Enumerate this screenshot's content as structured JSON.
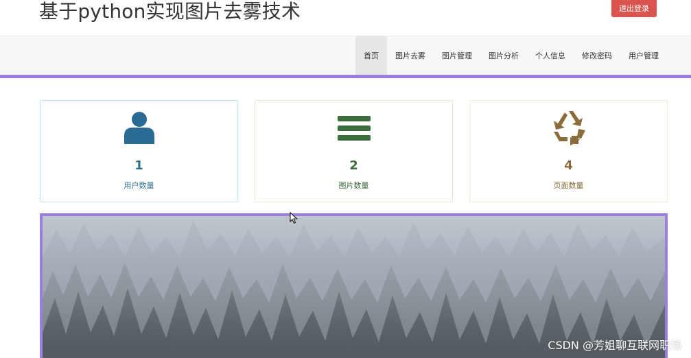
{
  "header": {
    "site_title": "基于python实现图片去雾技术",
    "logout_label": "退出登录"
  },
  "nav": {
    "items": [
      {
        "label": "首页",
        "active": true
      },
      {
        "label": "图片去雾",
        "active": false
      },
      {
        "label": "图片管理",
        "active": false
      },
      {
        "label": "图片分析",
        "active": false
      },
      {
        "label": "个人信息",
        "active": false
      },
      {
        "label": "修改密码",
        "active": false
      },
      {
        "label": "用户管理",
        "active": false
      }
    ]
  },
  "stats": [
    {
      "icon": "user-icon",
      "value": "1",
      "label": "用户数量",
      "color": "#31708f"
    },
    {
      "icon": "list-icon",
      "value": "2",
      "label": "图片数量",
      "color": "#3c6d3c"
    },
    {
      "icon": "recycle-icon",
      "value": "4",
      "label": "页面数量",
      "color": "#8a6d3b"
    }
  ],
  "banner": {
    "image": "foggy-forest-photo"
  },
  "watermark": "CSDN @芳姐聊互联网职场",
  "colors": {
    "accent": "#9b7fe0",
    "danger": "#d9534f",
    "navbar_bg": "#f8f8f8",
    "info": "#31708f",
    "success": "#3c6d3c",
    "warning": "#8a6d3b"
  }
}
